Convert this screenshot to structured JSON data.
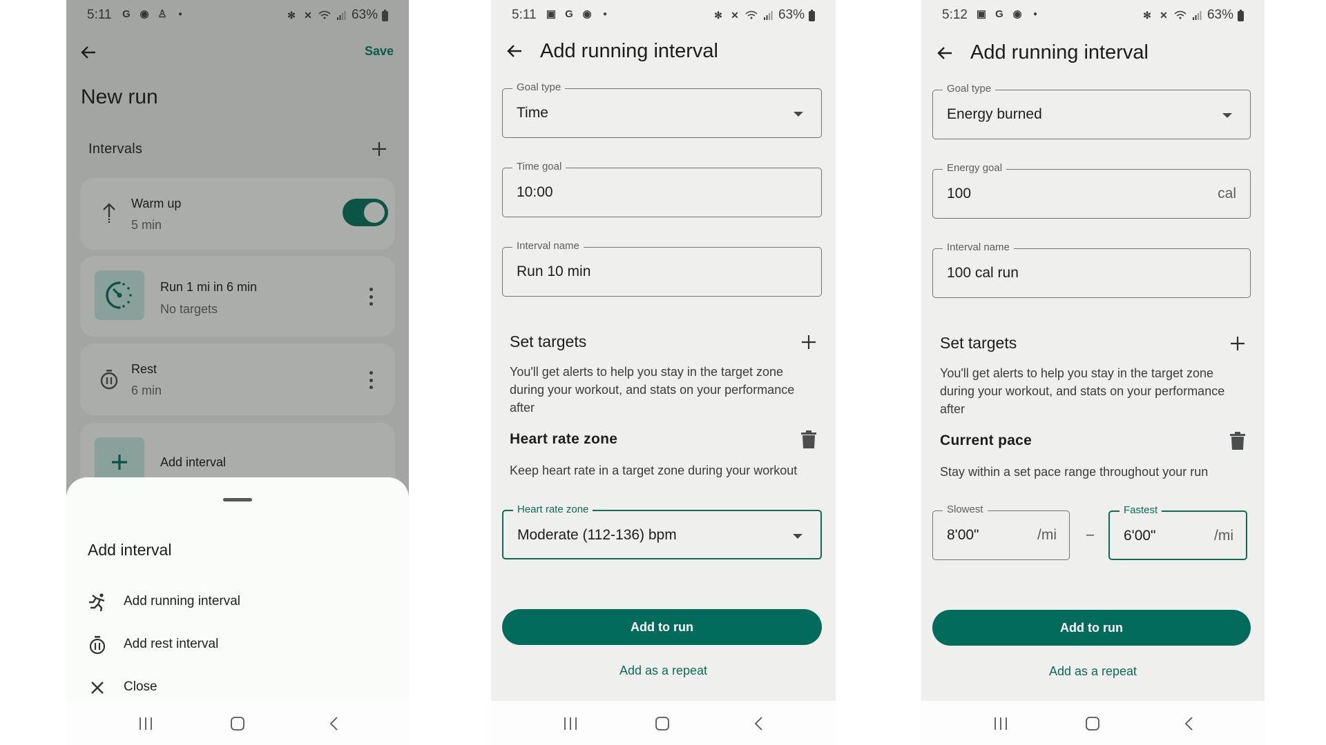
{
  "screens": [
    {
      "status_bar": {
        "time": "5:11",
        "battery": "63%",
        "left_icons": [
          "google-icon",
          "fitness-heart-icon",
          "notification-icon",
          "dot-icon"
        ],
        "right_icons": [
          "bluetooth-icon",
          "mute-icon",
          "wifi-icon",
          "signal-icon",
          "battery-icon"
        ]
      },
      "header": {
        "save_label": "Save",
        "title": "New run"
      },
      "intervals": {
        "label": "Intervals",
        "items": [
          {
            "title": "Warm up",
            "subtitle": "5 min",
            "icon": "warmup-arrow-icon",
            "toggle_on": true
          },
          {
            "title": "Run 1 mi in 6 min",
            "subtitle": "No targets",
            "icon": "pace-timer-icon"
          },
          {
            "title": "Rest",
            "subtitle": "6 min",
            "icon": "rest-timer-icon"
          },
          {
            "title": "Add interval",
            "icon": "plus-icon"
          }
        ]
      },
      "sheet": {
        "title": "Add interval",
        "items": [
          {
            "label": "Add running interval",
            "icon": "running-icon"
          },
          {
            "label": "Add rest interval",
            "icon": "rest-timer-icon"
          },
          {
            "label": "Close",
            "icon": "close-icon"
          }
        ]
      }
    },
    {
      "status_bar": {
        "time": "5:11",
        "battery": "63%",
        "left_icons": [
          "gallery-icon",
          "google-icon",
          "fitness-heart-icon",
          "dot-icon"
        ],
        "right_icons": [
          "bluetooth-icon",
          "mute-icon",
          "wifi-icon",
          "signal-icon",
          "battery-icon"
        ]
      },
      "title": "Add running interval",
      "goal_type": {
        "label": "Goal type",
        "value": "Time"
      },
      "goal": {
        "label": "Time goal",
        "value": "10:00"
      },
      "interval_name": {
        "label": "Interval name",
        "value": "Run 10 min"
      },
      "targets": {
        "title": "Set targets",
        "description": "You'll get alerts to help you stay in the target zone during your workout, and stats on your performance after",
        "target_title": "Heart rate zone",
        "target_description": "Keep heart rate in a target zone during your workout",
        "zone_select": {
          "label": "Heart rate zone",
          "value": "Moderate (112-136) bpm"
        }
      },
      "primary_button": "Add to run",
      "secondary_button": "Add as a repeat"
    },
    {
      "status_bar": {
        "time": "5:12",
        "battery": "63%",
        "left_icons": [
          "gallery-icon",
          "google-icon",
          "fitness-heart-icon",
          "dot-icon"
        ],
        "right_icons": [
          "bluetooth-icon",
          "mute-icon",
          "wifi-icon",
          "signal-icon",
          "battery-icon"
        ]
      },
      "title": "Add running interval",
      "goal_type": {
        "label": "Goal type",
        "value": "Energy burned"
      },
      "goal": {
        "label": "Energy goal",
        "value": "100",
        "suffix": "cal"
      },
      "interval_name": {
        "label": "Interval name",
        "value": "100 cal run"
      },
      "targets": {
        "title": "Set targets",
        "description": "You'll get alerts to help you stay in the target zone during your workout, and stats on your performance after",
        "target_title": "Current pace",
        "target_description": "Stay within a set pace range throughout your run",
        "slowest": {
          "label": "Slowest",
          "value": "8'00\"",
          "suffix": "/mi"
        },
        "separator": "–",
        "fastest": {
          "label": "Fastest",
          "value": "6'00\"",
          "suffix": "/mi"
        }
      },
      "primary_button": "Add to run",
      "secondary_button": "Add as a repeat"
    }
  ],
  "colors": {
    "accent": "#026b5b",
    "surface": "#eff0ee",
    "scrim": "#a3a5a2",
    "sheet": "#fafcfa"
  }
}
